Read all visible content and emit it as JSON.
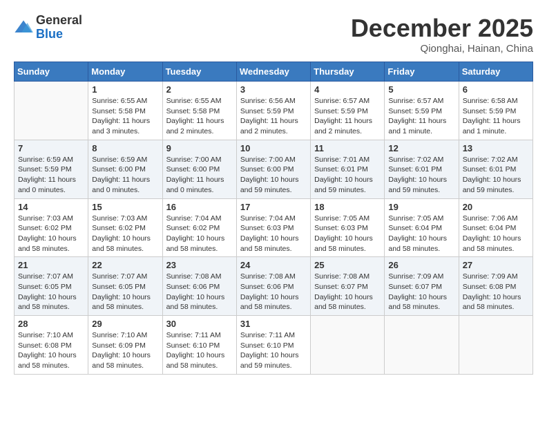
{
  "header": {
    "logo_general": "General",
    "logo_blue": "Blue",
    "month_title": "December 2025",
    "location": "Qionghai, Hainan, China"
  },
  "weekdays": [
    "Sunday",
    "Monday",
    "Tuesday",
    "Wednesday",
    "Thursday",
    "Friday",
    "Saturday"
  ],
  "weeks": [
    [
      {
        "day": "",
        "sunrise": "",
        "sunset": "",
        "daylight": ""
      },
      {
        "day": "1",
        "sunrise": "Sunrise: 6:55 AM",
        "sunset": "Sunset: 5:58 PM",
        "daylight": "Daylight: 11 hours and 3 minutes."
      },
      {
        "day": "2",
        "sunrise": "Sunrise: 6:55 AM",
        "sunset": "Sunset: 5:58 PM",
        "daylight": "Daylight: 11 hours and 2 minutes."
      },
      {
        "day": "3",
        "sunrise": "Sunrise: 6:56 AM",
        "sunset": "Sunset: 5:59 PM",
        "daylight": "Daylight: 11 hours and 2 minutes."
      },
      {
        "day": "4",
        "sunrise": "Sunrise: 6:57 AM",
        "sunset": "Sunset: 5:59 PM",
        "daylight": "Daylight: 11 hours and 2 minutes."
      },
      {
        "day": "5",
        "sunrise": "Sunrise: 6:57 AM",
        "sunset": "Sunset: 5:59 PM",
        "daylight": "Daylight: 11 hours and 1 minute."
      },
      {
        "day": "6",
        "sunrise": "Sunrise: 6:58 AM",
        "sunset": "Sunset: 5:59 PM",
        "daylight": "Daylight: 11 hours and 1 minute."
      }
    ],
    [
      {
        "day": "7",
        "sunrise": "Sunrise: 6:59 AM",
        "sunset": "Sunset: 5:59 PM",
        "daylight": "Daylight: 11 hours and 0 minutes."
      },
      {
        "day": "8",
        "sunrise": "Sunrise: 6:59 AM",
        "sunset": "Sunset: 6:00 PM",
        "daylight": "Daylight: 11 hours and 0 minutes."
      },
      {
        "day": "9",
        "sunrise": "Sunrise: 7:00 AM",
        "sunset": "Sunset: 6:00 PM",
        "daylight": "Daylight: 11 hours and 0 minutes."
      },
      {
        "day": "10",
        "sunrise": "Sunrise: 7:00 AM",
        "sunset": "Sunset: 6:00 PM",
        "daylight": "Daylight: 10 hours and 59 minutes."
      },
      {
        "day": "11",
        "sunrise": "Sunrise: 7:01 AM",
        "sunset": "Sunset: 6:01 PM",
        "daylight": "Daylight: 10 hours and 59 minutes."
      },
      {
        "day": "12",
        "sunrise": "Sunrise: 7:02 AM",
        "sunset": "Sunset: 6:01 PM",
        "daylight": "Daylight: 10 hours and 59 minutes."
      },
      {
        "day": "13",
        "sunrise": "Sunrise: 7:02 AM",
        "sunset": "Sunset: 6:01 PM",
        "daylight": "Daylight: 10 hours and 59 minutes."
      }
    ],
    [
      {
        "day": "14",
        "sunrise": "Sunrise: 7:03 AM",
        "sunset": "Sunset: 6:02 PM",
        "daylight": "Daylight: 10 hours and 58 minutes."
      },
      {
        "day": "15",
        "sunrise": "Sunrise: 7:03 AM",
        "sunset": "Sunset: 6:02 PM",
        "daylight": "Daylight: 10 hours and 58 minutes."
      },
      {
        "day": "16",
        "sunrise": "Sunrise: 7:04 AM",
        "sunset": "Sunset: 6:02 PM",
        "daylight": "Daylight: 10 hours and 58 minutes."
      },
      {
        "day": "17",
        "sunrise": "Sunrise: 7:04 AM",
        "sunset": "Sunset: 6:03 PM",
        "daylight": "Daylight: 10 hours and 58 minutes."
      },
      {
        "day": "18",
        "sunrise": "Sunrise: 7:05 AM",
        "sunset": "Sunset: 6:03 PM",
        "daylight": "Daylight: 10 hours and 58 minutes."
      },
      {
        "day": "19",
        "sunrise": "Sunrise: 7:05 AM",
        "sunset": "Sunset: 6:04 PM",
        "daylight": "Daylight: 10 hours and 58 minutes."
      },
      {
        "day": "20",
        "sunrise": "Sunrise: 7:06 AM",
        "sunset": "Sunset: 6:04 PM",
        "daylight": "Daylight: 10 hours and 58 minutes."
      }
    ],
    [
      {
        "day": "21",
        "sunrise": "Sunrise: 7:07 AM",
        "sunset": "Sunset: 6:05 PM",
        "daylight": "Daylight: 10 hours and 58 minutes."
      },
      {
        "day": "22",
        "sunrise": "Sunrise: 7:07 AM",
        "sunset": "Sunset: 6:05 PM",
        "daylight": "Daylight: 10 hours and 58 minutes."
      },
      {
        "day": "23",
        "sunrise": "Sunrise: 7:08 AM",
        "sunset": "Sunset: 6:06 PM",
        "daylight": "Daylight: 10 hours and 58 minutes."
      },
      {
        "day": "24",
        "sunrise": "Sunrise: 7:08 AM",
        "sunset": "Sunset: 6:06 PM",
        "daylight": "Daylight: 10 hours and 58 minutes."
      },
      {
        "day": "25",
        "sunrise": "Sunrise: 7:08 AM",
        "sunset": "Sunset: 6:07 PM",
        "daylight": "Daylight: 10 hours and 58 minutes."
      },
      {
        "day": "26",
        "sunrise": "Sunrise: 7:09 AM",
        "sunset": "Sunset: 6:07 PM",
        "daylight": "Daylight: 10 hours and 58 minutes."
      },
      {
        "day": "27",
        "sunrise": "Sunrise: 7:09 AM",
        "sunset": "Sunset: 6:08 PM",
        "daylight": "Daylight: 10 hours and 58 minutes."
      }
    ],
    [
      {
        "day": "28",
        "sunrise": "Sunrise: 7:10 AM",
        "sunset": "Sunset: 6:08 PM",
        "daylight": "Daylight: 10 hours and 58 minutes."
      },
      {
        "day": "29",
        "sunrise": "Sunrise: 7:10 AM",
        "sunset": "Sunset: 6:09 PM",
        "daylight": "Daylight: 10 hours and 58 minutes."
      },
      {
        "day": "30",
        "sunrise": "Sunrise: 7:11 AM",
        "sunset": "Sunset: 6:10 PM",
        "daylight": "Daylight: 10 hours and 58 minutes."
      },
      {
        "day": "31",
        "sunrise": "Sunrise: 7:11 AM",
        "sunset": "Sunset: 6:10 PM",
        "daylight": "Daylight: 10 hours and 59 minutes."
      },
      {
        "day": "",
        "sunrise": "",
        "sunset": "",
        "daylight": ""
      },
      {
        "day": "",
        "sunrise": "",
        "sunset": "",
        "daylight": ""
      },
      {
        "day": "",
        "sunrise": "",
        "sunset": "",
        "daylight": ""
      }
    ]
  ]
}
